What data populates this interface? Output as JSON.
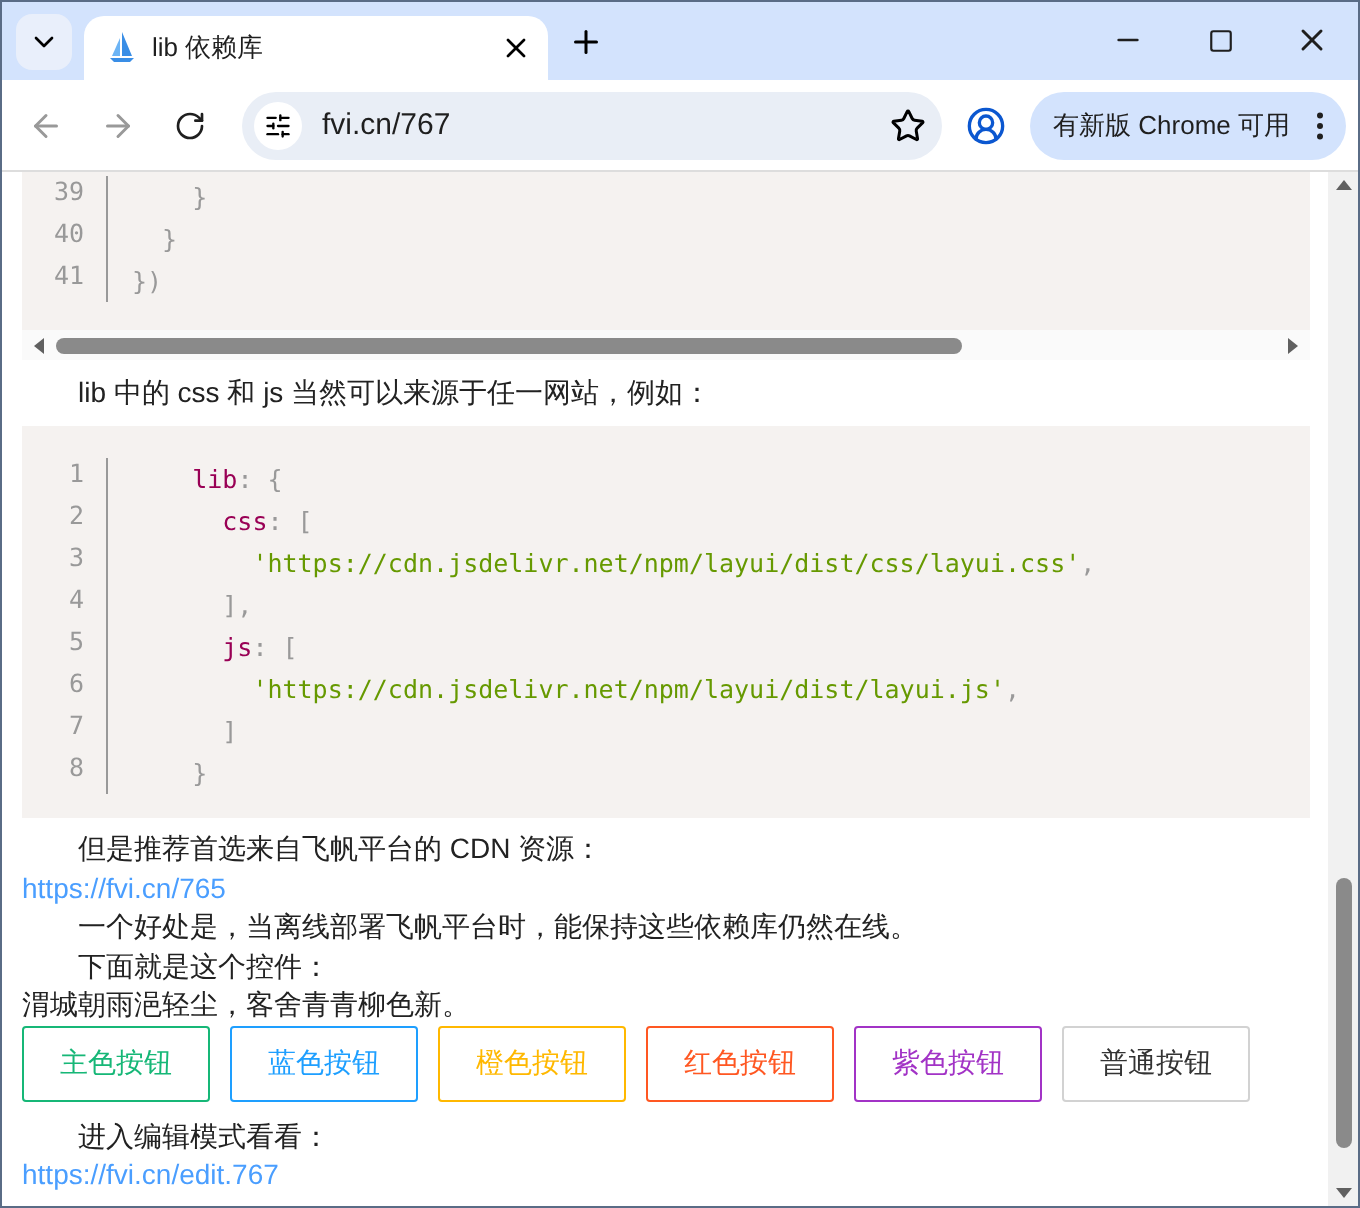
{
  "browser": {
    "tab_title": "lib 依赖库",
    "address": "fvi.cn/767",
    "update_button": "有新版 Chrome 可用"
  },
  "code_block_top": {
    "lines": [
      {
        "number": "39",
        "tokens": [
          {
            "kind": "punct",
            "text": "    }"
          }
        ]
      },
      {
        "number": "40",
        "tokens": [
          {
            "kind": "punct",
            "text": "  }"
          }
        ]
      },
      {
        "number": "41",
        "tokens": [
          {
            "kind": "punct",
            "text": "})"
          }
        ]
      }
    ]
  },
  "intro_text": "lib 中的 css 和 js 当然可以来源于任一网站，例如：",
  "code_block": {
    "lines": [
      {
        "number": "1",
        "tokens": [
          {
            "kind": "key",
            "text": "    lib"
          },
          {
            "kind": "punct",
            "text": ": {"
          }
        ]
      },
      {
        "number": "2",
        "tokens": [
          {
            "kind": "key",
            "text": "      css"
          },
          {
            "kind": "punct",
            "text": ": ["
          }
        ]
      },
      {
        "number": "3",
        "tokens": [
          {
            "kind": "string",
            "text": "        'https://cdn.jsdelivr.net/npm/layui/dist/css/layui.css'"
          },
          {
            "kind": "punct",
            "text": ","
          }
        ]
      },
      {
        "number": "4",
        "tokens": [
          {
            "kind": "punct",
            "text": "      ],"
          }
        ]
      },
      {
        "number": "5",
        "tokens": [
          {
            "kind": "key",
            "text": "      js"
          },
          {
            "kind": "punct",
            "text": ": ["
          }
        ]
      },
      {
        "number": "6",
        "tokens": [
          {
            "kind": "string",
            "text": "        'https://cdn.jsdelivr.net/npm/layui/dist/layui.js'"
          },
          {
            "kind": "punct",
            "text": ","
          }
        ]
      },
      {
        "number": "7",
        "tokens": [
          {
            "kind": "punct",
            "text": "      ]"
          }
        ]
      },
      {
        "number": "8",
        "tokens": [
          {
            "kind": "punct",
            "text": "    }"
          }
        ]
      }
    ]
  },
  "paragraphs": [
    {
      "kind": "text",
      "text": "但是推荐首选来自飞帆平台的 CDN 资源："
    },
    {
      "kind": "link",
      "text": "https://fvi.cn/765"
    },
    {
      "kind": "text",
      "text": "一个好处是，当离线部署飞帆平台时，能保持这些依赖库仍然在线。"
    },
    {
      "kind": "text",
      "text": "下面就是这个控件："
    },
    {
      "kind": "plain",
      "text": "渭城朝雨浥轻尘，客舍青青柳色新。"
    }
  ],
  "buttons": [
    {
      "label": "主色按钮",
      "kind": "colored",
      "color": "#16b777"
    },
    {
      "label": "蓝色按钮",
      "kind": "colored",
      "color": "#1e9fff"
    },
    {
      "label": "橙色按钮",
      "kind": "colored",
      "color": "#ffb800"
    },
    {
      "label": "红色按钮",
      "kind": "colored",
      "color": "#ff5722"
    },
    {
      "label": "紫色按钮",
      "kind": "colored",
      "color": "#a233c6"
    },
    {
      "label": "普通按钮",
      "kind": "plain",
      "color": "#d2d2d2"
    }
  ],
  "footer": [
    {
      "kind": "text",
      "text": "进入编辑模式看看："
    },
    {
      "kind": "link",
      "text": "https://fvi.cn/edit.767"
    }
  ]
}
